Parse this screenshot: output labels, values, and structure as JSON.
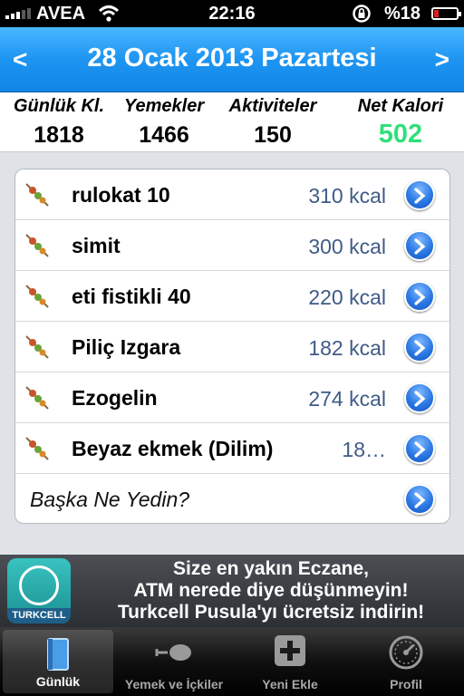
{
  "status_bar": {
    "carrier": "AVEA",
    "time": "22:16",
    "battery": "%18"
  },
  "header": {
    "title": "28 Ocak 2013 Pazartesi",
    "prev": "<",
    "next": ">"
  },
  "summary": {
    "daily_label": "Günlük Kl.",
    "daily_value": "1818",
    "foods_label": "Yemekler",
    "foods_value": "1466",
    "activities_label": "Aktiviteler",
    "activities_value": "150",
    "net_label": "Net Kalori",
    "net_value": "502",
    "net_color": "#2fe07a"
  },
  "foods": [
    {
      "name": "rulokat 10",
      "kcal": "310 kcal"
    },
    {
      "name": "simit",
      "kcal": "300 kcal"
    },
    {
      "name": "eti fistikli 40",
      "kcal": "220 kcal"
    },
    {
      "name": "Piliç Izgara",
      "kcal": "182 kcal"
    },
    {
      "name": "Ezogelin",
      "kcal": "274 kcal"
    },
    {
      "name": "Beyaz ekmek (Dilim)",
      "kcal": "18…"
    }
  ],
  "add_prompt": "Başka Ne Yedin?",
  "ad": {
    "logo_text": "TURKCELL",
    "line1": "Size en yakın Eczane,",
    "line2": "ATM nerede diye düşünmeyin!",
    "line3": "Turkcell Pusula'yı ücretsiz indirin!"
  },
  "tabs": [
    {
      "label": "Günlük",
      "icon": "book-icon"
    },
    {
      "label": "Yemek ve İçkiler",
      "icon": "food-icon"
    },
    {
      "label": "Yeni Ekle",
      "icon": "plus-icon"
    },
    {
      "label": "Profil",
      "icon": "gauge-icon"
    }
  ]
}
